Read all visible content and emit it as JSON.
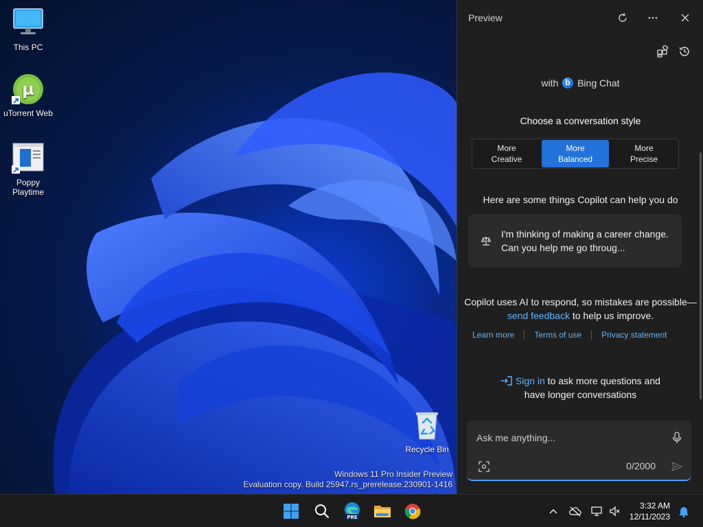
{
  "desktop": {
    "icons": [
      {
        "label": "This PC"
      },
      {
        "label": "uTorrent Web"
      },
      {
        "label": "Poppy Playtime"
      },
      {
        "label": "Recycle Bin"
      }
    ],
    "watermark": {
      "line1": "Windows 11 Pro Insider Preview",
      "line2": "Evaluation copy. Build 25947.rs_prerelease.230901-1416"
    }
  },
  "copilot": {
    "title": "Preview",
    "with_prefix": "with",
    "brand": "Bing Chat",
    "style_heading": "Choose a conversation style",
    "styles": [
      {
        "line1": "More",
        "line2": "Creative"
      },
      {
        "line1": "More",
        "line2": "Balanced"
      },
      {
        "line1": "More",
        "line2": "Precise"
      }
    ],
    "selected_style": "More Balanced",
    "help_heading": "Here are some things Copilot can help you do",
    "suggestion": "I'm thinking of making a career change. Can you help me go throug...",
    "disclaimer": {
      "part1": "Copilot uses AI to respond, so mistakes are possible—",
      "link": "send feedback",
      "part2": " to help us improve."
    },
    "footer_links": [
      "Learn more",
      "Terms of use",
      "Privacy statement"
    ],
    "signin": {
      "link": "Sign in",
      "text1": " to ask more questions and",
      "text2": "have longer conversations"
    },
    "composer": {
      "placeholder": "Ask me anything...",
      "char_count": "0/2000"
    }
  },
  "taskbar": {
    "time": "3:32 AM",
    "date": "12/11/2023",
    "edge_badge": "PRE"
  },
  "colors": {
    "accent": "#2372d9",
    "link": "#61b4ff",
    "pane_bg": "#1f1f1f"
  }
}
